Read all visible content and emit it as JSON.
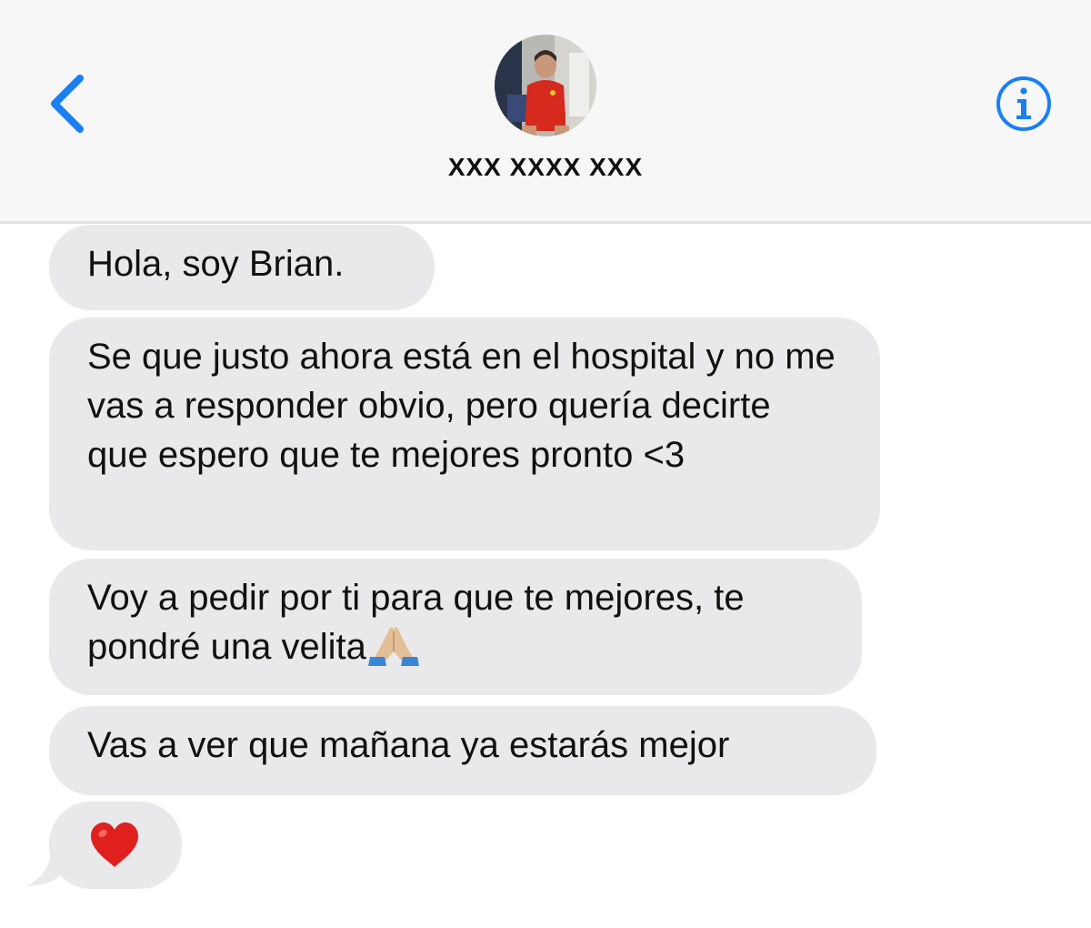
{
  "header": {
    "back_icon": "chevron-left-icon",
    "contact_name": "XXX XXXX XXX",
    "info_icon": "info-circle-icon",
    "accent_color": "#1a7ff5"
  },
  "messages": [
    {
      "text": "Hola, soy Brian."
    },
    {
      "text": "Se que justo ahora está en el hospital y no me vas a responder obvio, pero quería decirte que espero que te mejores pronto <3"
    },
    {
      "text": "Voy a pedir por ti para que te mejores, te pondré una velita",
      "emoji": "folded-hands-icon"
    },
    {
      "text": "Vas a ver que mañana ya estarás mejor"
    },
    {
      "emoji": "red-heart-icon"
    }
  ],
  "colors": {
    "bubble_received": "#e9e9eb",
    "text": "#111111",
    "header_bg": "#f7f7f7"
  }
}
